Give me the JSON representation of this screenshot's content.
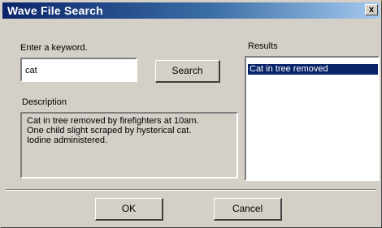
{
  "window": {
    "title": "Wave File Search",
    "close_glyph": "x"
  },
  "search": {
    "label": "Enter a keyword.",
    "value": "cat",
    "button_label": "Search"
  },
  "description": {
    "label": "Description",
    "lines": [
      "Cat in tree removed by firefighters at 10am.",
      "One child slight scraped by hysterical cat.",
      "Iodine administered."
    ]
  },
  "results": {
    "label": "Results",
    "items": [
      "Cat in tree removed"
    ],
    "selected_index": 0
  },
  "footer": {
    "ok_label": "OK",
    "cancel_label": "Cancel"
  },
  "colors": {
    "titlebar_start": "#0a246a",
    "titlebar_end": "#a6caf0",
    "dialog_face": "#d4d0c8",
    "selection": "#0a246a"
  }
}
